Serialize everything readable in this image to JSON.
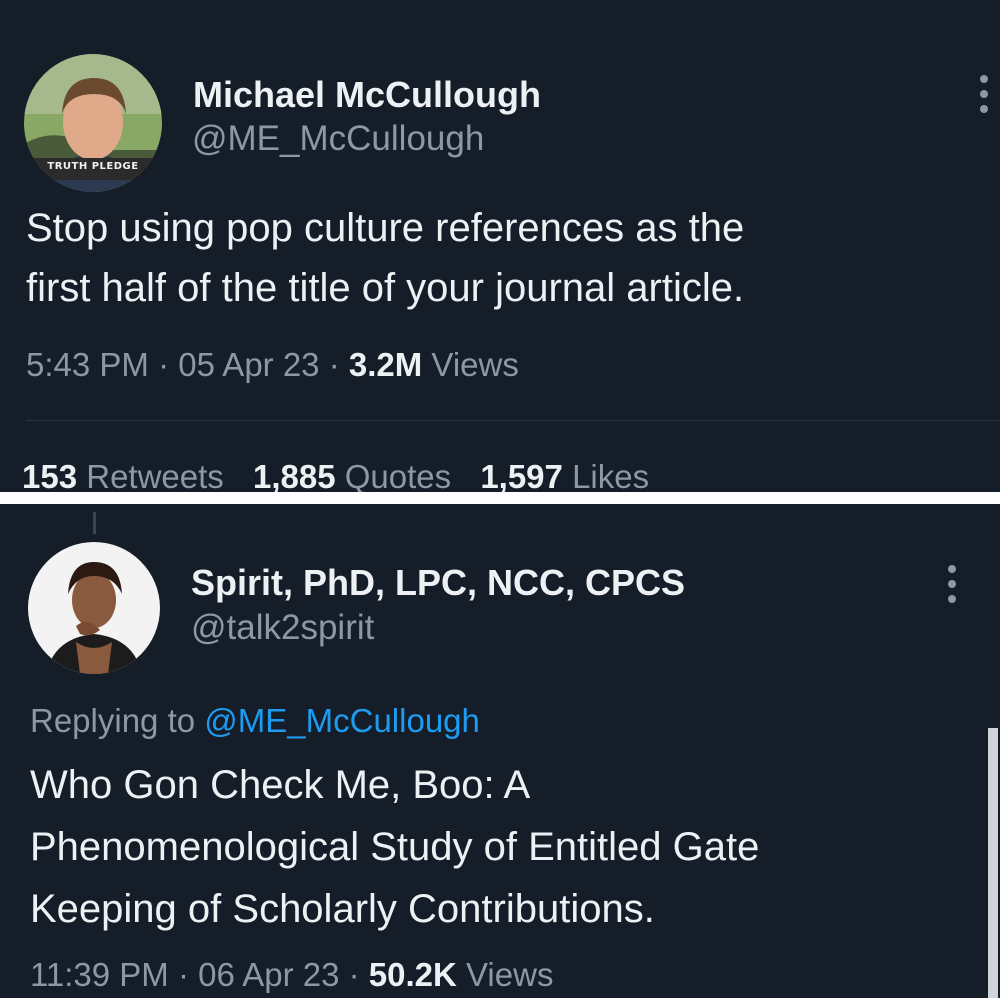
{
  "tweet": {
    "author_name": "Michael McCullough",
    "author_handle": "@ME_McCullough",
    "avatar_badge": "TRUTH PLEDGE",
    "text_line1": "Stop using pop culture references as the",
    "text_line2": "first half of the title of your journal article.",
    "time": "5:43 PM",
    "date": "05 Apr 23",
    "views_count": "3.2M",
    "views_label": "Views",
    "separator": "·",
    "stats": [
      {
        "count": "153",
        "label": "Retweets"
      },
      {
        "count": "1,885",
        "label": "Quotes"
      },
      {
        "count": "1,597",
        "label": "Likes"
      }
    ]
  },
  "reply": {
    "author_name": "Spirit, PhD, LPC, NCC, CPCS",
    "author_handle": "@talk2spirit",
    "replying_to_label": "Replying to",
    "replying_to_handle": "@ME_McCullough",
    "text_line1": "Who Gon Check Me, Boo: A",
    "text_line2": "Phenomenological Study of Entitled Gate",
    "text_line3": "Keeping of Scholarly Contributions.",
    "time": "11:39 PM",
    "date": "06 Apr 23",
    "views_count": "50.2K",
    "views_label": "Views",
    "separator": "·"
  },
  "icons": {
    "more": "more-vertical-icon"
  },
  "colors": {
    "background": "#151d28",
    "text_primary": "#eef1f4",
    "text_secondary": "#8b98a5",
    "accent": "#1d9bf0",
    "separator_band": "#ffffff"
  }
}
